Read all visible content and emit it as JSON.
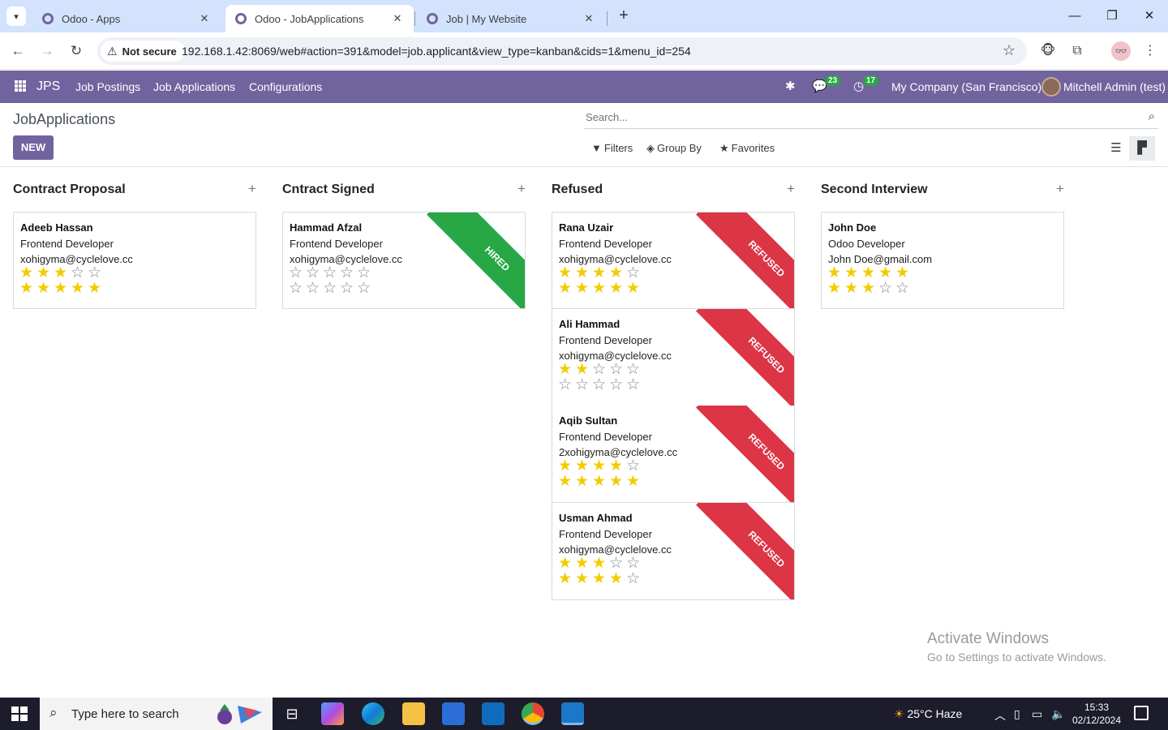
{
  "browser": {
    "tabs": [
      {
        "title": "Odoo - Apps",
        "active": false
      },
      {
        "title": "Odoo - JobApplications",
        "active": true
      },
      {
        "title": "Job | My Website",
        "active": false
      }
    ],
    "security_label": "Not secure",
    "url": "192.168.1.42:8069/web#action=391&model=job.applicant&view_type=kanban&cids=1&menu_id=254"
  },
  "navbar": {
    "brand": "JPS",
    "menu": [
      "Job Postings",
      "Job Applications",
      "Configurations"
    ],
    "messages_count": "23",
    "activities_count": "17",
    "company": "My Company (San Francisco)",
    "user": "Mitchell Admin (test)",
    "accent_color": "#71639e"
  },
  "control_panel": {
    "breadcrumb": "JobApplications",
    "new_label": "NEW",
    "search_placeholder": "Search...",
    "filters_label": "Filters",
    "groupby_label": "Group By",
    "favorites_label": "Favorites"
  },
  "kanban": {
    "columns": [
      {
        "title": "Contract Proposal",
        "cards": [
          {
            "name": "Adeeb Hassan",
            "job": "Frontend Developer",
            "email": "xohigyma@cyclelove.cc",
            "priority": 3,
            "rating": 5,
            "ribbon": ""
          }
        ]
      },
      {
        "title": "Cntract Signed",
        "cards": [
          {
            "name": "Hammad Afzal",
            "job": "Frontend Developer",
            "email": "xohigyma@cyclelove.cc",
            "priority": 0,
            "rating": 0,
            "ribbon": "HIRED"
          }
        ]
      },
      {
        "title": "Refused",
        "cards": [
          {
            "name": "Rana Uzair",
            "job": "Frontend Developer",
            "email": "xohigyma@cyclelove.cc",
            "priority": 4,
            "rating": 5,
            "ribbon": "REFUSED"
          },
          {
            "name": "Ali Hammad",
            "job": "Frontend Developer",
            "email": "xohigyma@cyclelove.cc",
            "priority": 2,
            "rating": 0,
            "ribbon": "REFUSED"
          },
          {
            "name": "Aqib Sultan",
            "job": "Frontend Developer",
            "email": "2xohigyma@cyclelove.cc",
            "priority": 4,
            "rating": 5,
            "ribbon": "REFUSED"
          },
          {
            "name": "Usman Ahmad",
            "job": "Frontend Developer",
            "email": "xohigyma@cyclelove.cc",
            "priority": 3,
            "rating": 4,
            "ribbon": "REFUSED"
          }
        ]
      },
      {
        "title": "Second Interview",
        "cards": [
          {
            "name": "John Doe",
            "job": "Odoo Developer",
            "email": "John Doe@gmail.com",
            "priority": 5,
            "rating": 3,
            "ribbon": ""
          }
        ]
      }
    ],
    "colors": {
      "star_on": "#f3cc00",
      "hired": "#28a745",
      "refused": "#dc3545"
    }
  },
  "watermark": {
    "line1": "Activate Windows",
    "line2": "Go to Settings to activate Windows."
  },
  "taskbar": {
    "search_placeholder": "Type here to search",
    "weather": "25°C  Haze",
    "time": "15:33",
    "date": "02/12/2024"
  }
}
